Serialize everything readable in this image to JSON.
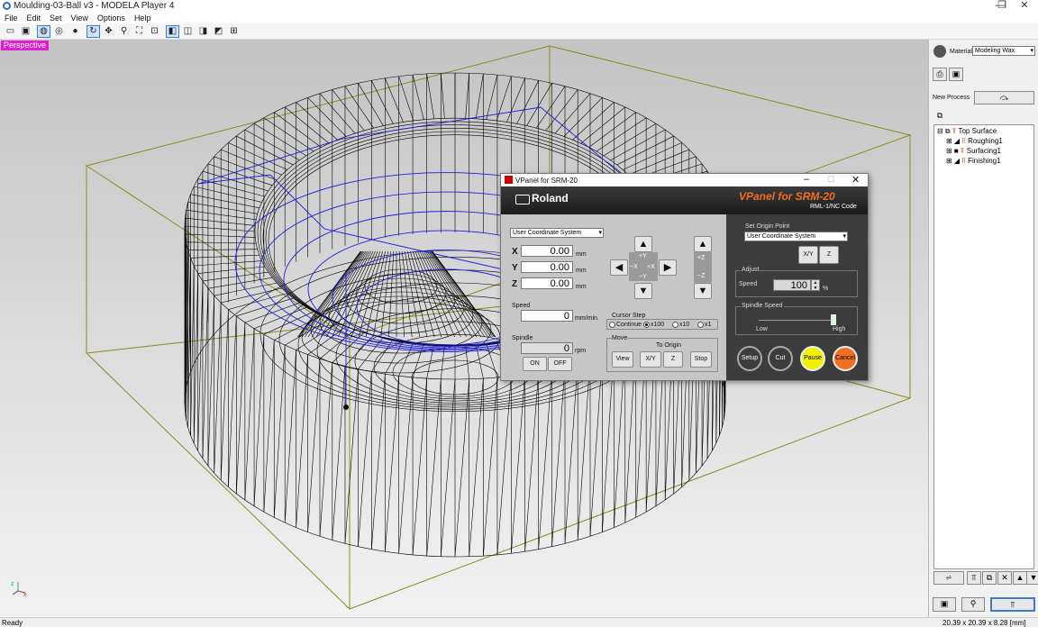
{
  "window": {
    "title": "Moulding-03-Ball v3 - MODELA Player 4",
    "minimize": "—",
    "restore": "❐",
    "close": "✕"
  },
  "menu": [
    "File",
    "Edit",
    "Set",
    "View",
    "Options",
    "Help"
  ],
  "viewport": {
    "mode_label": "Perspective"
  },
  "right_panel": {
    "material_label": "Material",
    "material_value": "Modeling Wax",
    "new_process_label": "New Process",
    "tree": {
      "root": "Top Surface",
      "items": [
        "Roughing1",
        "Surfacing1",
        "Finishing1"
      ]
    }
  },
  "statusbar": {
    "status": "Ready",
    "dimensions": "20.39 x 20.39 x 8.28 [mm]"
  },
  "vpanel": {
    "title": "VPanel for SRM-20",
    "brand": "Roland",
    "product": "VPanel for SRM-20",
    "subtitle": "RML-1/NC Code",
    "coord_system": "User Coordinate System",
    "x_label": "X",
    "x_value": "0.00",
    "y_label": "Y",
    "y_value": "0.00",
    "z_label": "Z",
    "z_value": "0.00",
    "unit_mm": "mm",
    "speed_label": "Speed",
    "speed_value": "0",
    "speed_unit": "mm/min.",
    "spindle_label": "Spindle",
    "spindle_value": "0",
    "spindle_unit": "rpm",
    "on_label": "ON",
    "off_label": "OFF",
    "jog": {
      "plus_y": "+Y",
      "minus_y": "−Y",
      "minus_x": "−X",
      "plus_x": "+X",
      "plus_z": "+Z",
      "minus_z": "−Z"
    },
    "cursor_step_label": "Cursor Step",
    "cursor_steps": [
      "Continue",
      "x100",
      "x10",
      "x1"
    ],
    "cursor_step_selected": "x100",
    "move_label": "Move",
    "to_origin_label": "To Origin",
    "view_btn": "View",
    "xy_btn": "X/Y",
    "z_btn": "Z",
    "stop_btn": "Stop",
    "set_origin_label": "Set Origin Point",
    "set_origin_coord": "User Coordinate System",
    "origin_xy_btn": "X/Y",
    "origin_z_btn": "Z",
    "adjust_label": "Adjust",
    "adjust_speed_label": "Speed",
    "adjust_speed_value": "100",
    "adjust_speed_unit": "%",
    "spindle_speed_label": "Spindle Speed",
    "spindle_speed_level": 1.0,
    "low_label": "Low",
    "high_label": "High",
    "setup_btn": "Setup",
    "cut_btn": "Cut",
    "pause_btn": "Pause",
    "cancel_btn": "Cancel"
  },
  "colors": {
    "perspective_badge": "#e020d0",
    "pause": "#f2f200",
    "cancel": "#f07020",
    "toolpath_blue": "#2020e0",
    "bbox_olive": "#8a8a20"
  }
}
